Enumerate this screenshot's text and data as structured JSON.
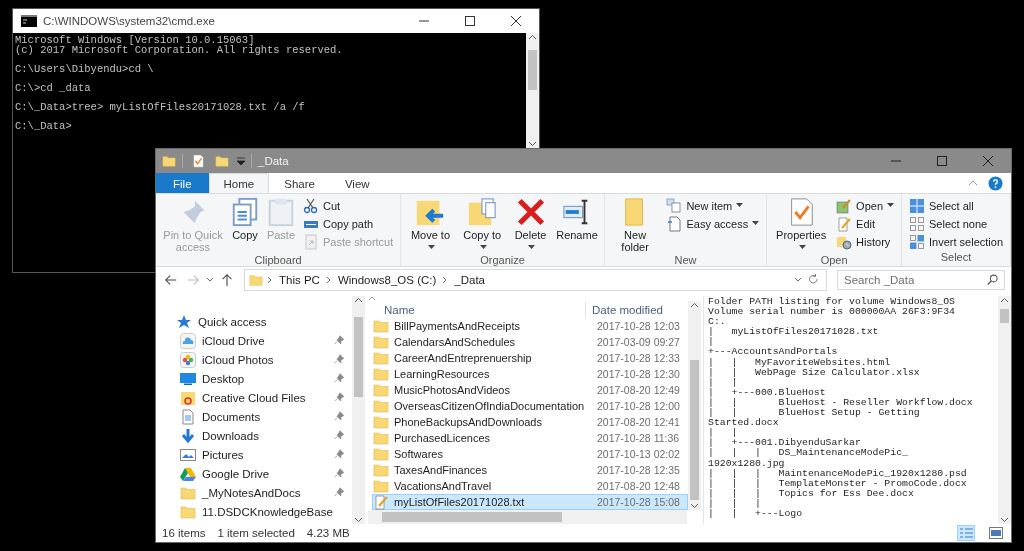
{
  "console": {
    "title": "C:\\WINDOWS\\system32\\cmd.exe",
    "text": "Microsoft Windows [Version 10.0.15063]\n(c) 2017 Microsoft Corporation. All rights reserved.\n\nC:\\Users\\Dibyendu>cd \\\n\nC:\\>cd _data\n\nC:\\_Data>tree> myListOfFiles20171028.txt /a /f\n\nC:\\_Data>"
  },
  "explorer": {
    "title": "_Data",
    "tabs": [
      {
        "label": "File",
        "kind": "file",
        "selected": false
      },
      {
        "label": "Home",
        "kind": "tab",
        "selected": true
      },
      {
        "label": "Share",
        "kind": "tab",
        "selected": false
      },
      {
        "label": "View",
        "kind": "tab",
        "selected": false
      }
    ],
    "ribbon_groups": [
      {
        "label": "Clipboard",
        "items": [
          {
            "label": "Pin to Quick access",
            "kind": "large",
            "disabled": true,
            "dropdown": false
          },
          {
            "label": "Copy",
            "kind": "large",
            "disabled": false,
            "dropdown": false
          },
          {
            "label": "Paste",
            "kind": "large",
            "disabled": true,
            "dropdown": false
          },
          {
            "label": "Cut",
            "kind": "small",
            "disabled": false,
            "dropdown": false
          },
          {
            "label": "Copy path",
            "kind": "small",
            "disabled": false,
            "dropdown": false
          },
          {
            "label": "Paste shortcut",
            "kind": "small",
            "disabled": true,
            "dropdown": false
          }
        ]
      },
      {
        "label": "Organize",
        "items": [
          {
            "label": "Move to",
            "kind": "large",
            "disabled": false,
            "dropdown": true
          },
          {
            "label": "Copy to",
            "kind": "large",
            "disabled": false,
            "dropdown": true
          },
          {
            "label": "Delete",
            "kind": "large",
            "disabled": false,
            "dropdown": true
          },
          {
            "label": "Rename",
            "kind": "large",
            "disabled": false,
            "dropdown": false
          }
        ]
      },
      {
        "label": "New",
        "items": [
          {
            "label": "New folder",
            "kind": "large",
            "disabled": false,
            "dropdown": false
          },
          {
            "label": "New item",
            "kind": "small",
            "disabled": false,
            "dropdown": true
          },
          {
            "label": "Easy access",
            "kind": "small",
            "disabled": false,
            "dropdown": true
          }
        ]
      },
      {
        "label": "Open",
        "items": [
          {
            "label": "Properties",
            "kind": "large",
            "disabled": false,
            "dropdown": true
          },
          {
            "label": "Open",
            "kind": "small",
            "disabled": false,
            "dropdown": true
          },
          {
            "label": "Edit",
            "kind": "small",
            "disabled": false,
            "dropdown": false
          },
          {
            "label": "History",
            "kind": "small",
            "disabled": false,
            "dropdown": false
          }
        ]
      },
      {
        "label": "Select",
        "items": [
          {
            "label": "Select all",
            "kind": "small",
            "disabled": false,
            "dropdown": false
          },
          {
            "label": "Select none",
            "kind": "small",
            "disabled": false,
            "dropdown": false
          },
          {
            "label": "Invert selection",
            "kind": "small",
            "disabled": false,
            "dropdown": false
          }
        ]
      }
    ],
    "address": {
      "crumbs": [
        "This PC",
        "Windows8_OS (C:)",
        "_Data"
      ]
    },
    "search": {
      "placeholder": "Search _Data"
    },
    "nav": {
      "items": [
        {
          "label": "Quick access",
          "kind": "header",
          "pinned": false
        },
        {
          "label": "iCloud Drive",
          "kind": "item",
          "pinned": true
        },
        {
          "label": "iCloud Photos",
          "kind": "item",
          "pinned": true
        },
        {
          "label": "Desktop",
          "kind": "item",
          "pinned": true
        },
        {
          "label": "Creative Cloud Files",
          "kind": "item",
          "pinned": true
        },
        {
          "label": "Documents",
          "kind": "item",
          "pinned": true
        },
        {
          "label": "Downloads",
          "kind": "item",
          "pinned": true
        },
        {
          "label": "Pictures",
          "kind": "item",
          "pinned": true
        },
        {
          "label": "Google Drive",
          "kind": "item",
          "pinned": true
        },
        {
          "label": "_MyNotesAndDocs",
          "kind": "item",
          "pinned": true
        },
        {
          "label": "11.DSDCKnowledgeBase",
          "kind": "item",
          "pinned": false
        }
      ]
    },
    "files": {
      "columns": [
        "Name",
        "Date modified"
      ],
      "rows": [
        {
          "name": "BillPaymentsAndReceipts",
          "date": "2017-10-28 12:03",
          "kind": "folder",
          "selected": false
        },
        {
          "name": "CalendarsAndSchedules",
          "date": "2017-03-09 09:27",
          "kind": "folder",
          "selected": false
        },
        {
          "name": "CareerAndEntreprenuership",
          "date": "2017-10-28 12:33",
          "kind": "folder",
          "selected": false
        },
        {
          "name": "LearningResources",
          "date": "2017-10-28 12:30",
          "kind": "folder",
          "selected": false
        },
        {
          "name": "MusicPhotosAndVideos",
          "date": "2017-08-20 12:49",
          "kind": "folder",
          "selected": false
        },
        {
          "name": "OverseasCitizenOfIndiaDocumentation",
          "date": "2017-10-28 12:00",
          "kind": "folder",
          "selected": false
        },
        {
          "name": "PhoneBackupsAndDownloads",
          "date": "2017-08-20 12:41",
          "kind": "folder",
          "selected": false
        },
        {
          "name": "PurchasedLicences",
          "date": "2017-10-28 11:36",
          "kind": "folder",
          "selected": false
        },
        {
          "name": "Softwares",
          "date": "2017-10-13 02:02",
          "kind": "folder",
          "selected": false
        },
        {
          "name": "TaxesAndFinances",
          "date": "2017-10-28 12:35",
          "kind": "folder",
          "selected": false
        },
        {
          "name": "VacationsAndTravel",
          "date": "2017-08-20 12:48",
          "kind": "folder",
          "selected": false
        },
        {
          "name": "myListOfFiles20171028.txt",
          "date": "2017-10-28 15:08",
          "kind": "text",
          "selected": true
        }
      ]
    },
    "preview": {
      "text": "Folder PATH listing for volume Windows8_OS\nVolume serial number is 000000AA 26F3:9F34\nC:.\n|   myListOfFiles20171028.txt\n|\n+---AccountsAndPortals\n|   |   MyFavoriteWebsites.html\n|   |   WebPage Size Calculator.xlsx\n|   |\n|   +---000.BlueHost\n|   |       BlueHost - Reseller Workflow.docx\n|   |       BlueHost Setup - Getting\nStarted.docx\n|   |\n|   +---001.DibyenduSarkar\n|   |   |   DS_MaintenanceModePic_\n1920x1280.jpg\n|   |   |   MaintenanceModePic_1920x1280.psd\n|   |   |   TemplateMonster - PromoCode.docx\n|   |   |   Topics for Ess Dee.docx\n|   |   |\n|   |   +---Logo"
    },
    "status": {
      "count": "16 items",
      "selection": "1 item selected",
      "size": "4.23 MB"
    },
    "views": [
      {
        "selected": true
      },
      {
        "selected": false
      }
    ]
  }
}
